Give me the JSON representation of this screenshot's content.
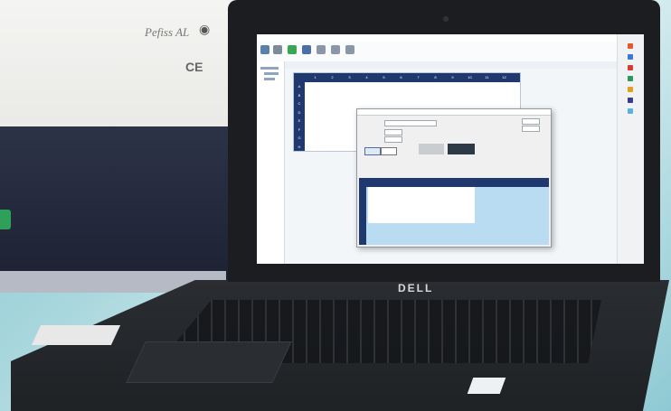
{
  "instrument": {
    "model_label": "Pefiss AL",
    "ce_mark": "CE"
  },
  "laptop": {
    "brand": "DELL"
  },
  "app": {
    "plate_columns": [
      "1",
      "2",
      "3",
      "4",
      "5",
      "6",
      "7",
      "8",
      "9",
      "10",
      "11",
      "12"
    ],
    "plate_rows": [
      "A",
      "B",
      "C",
      "D",
      "E",
      "F",
      "G",
      "H"
    ],
    "colors": {
      "header_navy": "#1f3870",
      "well_blue": "#b9dcf2",
      "titlebar": "#ffffff"
    }
  }
}
